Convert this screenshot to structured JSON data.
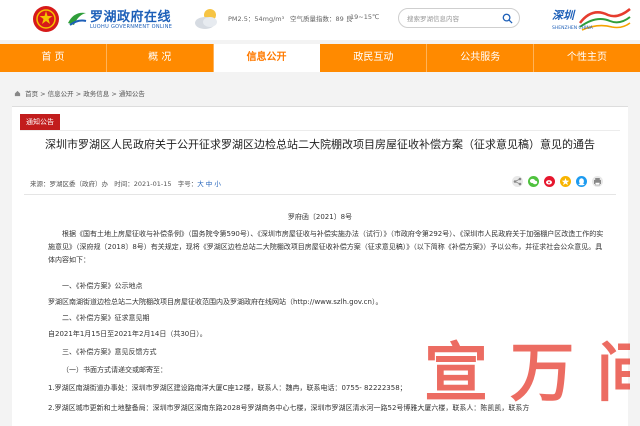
{
  "header": {
    "site_name": "罗湖政府在线",
    "site_sub": "LUOHU GOVERNMENT ONLINE",
    "weather": {
      "pm25": "PM2.5：54mg/m³",
      "air_quality": "空气质量指数：89 良",
      "temperature": "19~15℃"
    },
    "search_placeholder": "搜索罗湖信息内容",
    "brand_text": "深圳 SHENZHEN CHINA",
    "brand_url": "www.sz.gov.cn"
  },
  "nav": {
    "items": [
      {
        "label": "首 页"
      },
      {
        "label": "概 况"
      },
      {
        "label": "信息公开"
      },
      {
        "label": "政民互动"
      },
      {
        "label": "公共服务"
      },
      {
        "label": "个性主页"
      }
    ],
    "active_index": 2
  },
  "breadcrumb": {
    "items": [
      "首页",
      "信息公开",
      "政务信息",
      "通知公告"
    ],
    "separator": " > "
  },
  "article": {
    "category_tag": "通知公告",
    "title": "深圳市罗湖区人民政府关于公开征求罗湖区边检总站二大院棚改项目房屋征收补偿方案（征求意见稿）意见的通告",
    "source_label": "来源：罗湖区委（政府）办",
    "time_label": "时间：2021-01-15",
    "font_size_label": "字号：",
    "size_large": "大",
    "size_medium": "中",
    "size_small": "小",
    "doc_number": "罗府函〔2021〕8号",
    "paragraphs": [
      "根据《国有土地上房屋征收与补偿条例》（国务院令第590号）、《深圳市房屋征收与补偿实施办法（试行）》（市政府令第292号）、《深圳市人民政府关于加强棚户区改造工作的实施意见》（深府规〔2018〕8号）有关规定，现将《罗湖区边检总站二大院棚改项目房屋征收补偿方案（征求意见稿）》（以下简称《补偿方案》）予以公布，并征求社会公众意见。具体内容如下：",
      "一、《补偿方案》公示地点",
      "罗湖区南湖街道边检总站二大院棚改项目房屋征收范围内及罗湖政府在线网站（http://www.szlh.gov.cn）。",
      "二、《补偿方案》征求意见期",
      "自2021年1月15日至2021年2月14日（共30日）。",
      "三、《补偿方案》意见反馈方式",
      "（一）书面方式请递交或邮寄至：",
      "1.罗湖区南湖街道办事处：深圳市罗湖区建设路南洋大厦C座12楼，联系人：魏冉，联系电话：0755- 82222358；",
      "2.罗湖区城市更新和土地整备局：深圳市罗湖区深南东路2028号罗湖商务中心七楼，深圳市罗湖区清水河一路52号博雅大厦六楼，联系人：陈凯凯，联系方"
    ]
  },
  "watermark_text": "宣 万 间",
  "colors": {
    "nav_bg": "#ff8a00",
    "nav_active_text": "#ff7a00",
    "tag_bg": "#c21d1d",
    "brand_blue": "#1d5fb8",
    "watermark": "#e63c2e"
  }
}
